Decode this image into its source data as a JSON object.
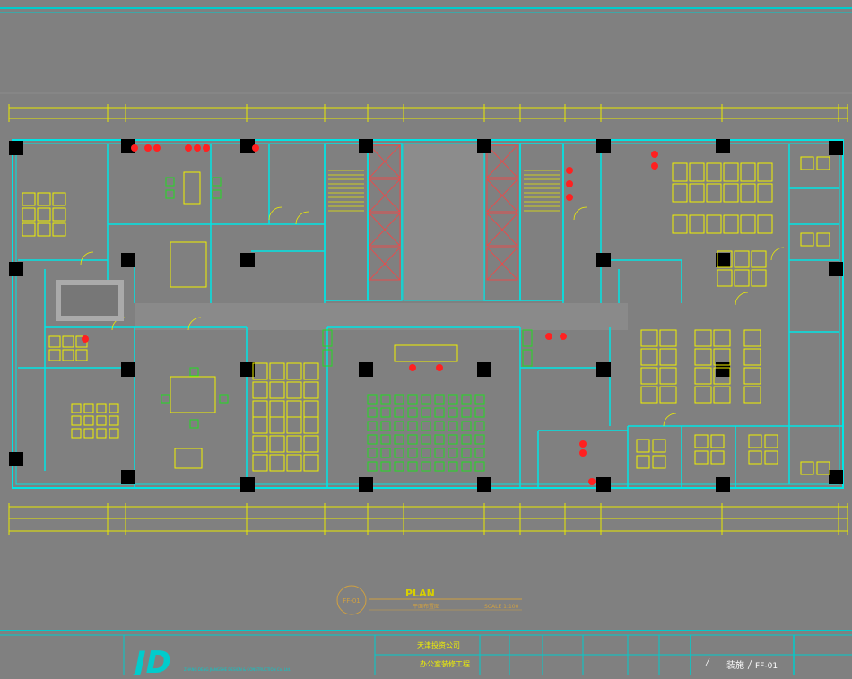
{
  "colors": {
    "background": "#808080",
    "wall": "#00e5e5",
    "furniture_yellow": "#f0f000",
    "furniture_green": "#22dd22",
    "accent_red": "#ff2020",
    "column": "#000000",
    "title_text": "#d8d000"
  },
  "plan_title": "PLAN",
  "plan_subtitle_left": "平面布置图",
  "plan_subtitle_right": "SCALE 1:100",
  "plan_number": "FF-01",
  "title_block": {
    "logo": "JD",
    "company_en": "ZHANG DENG JIANGSHE DESIGN & CONSTRUCTION Co. Ltd.",
    "project_line1": "天津投资公司",
    "project_line2": "办公室装修工程",
    "drawing_type": "装施",
    "drawing_number": "FF-01"
  }
}
